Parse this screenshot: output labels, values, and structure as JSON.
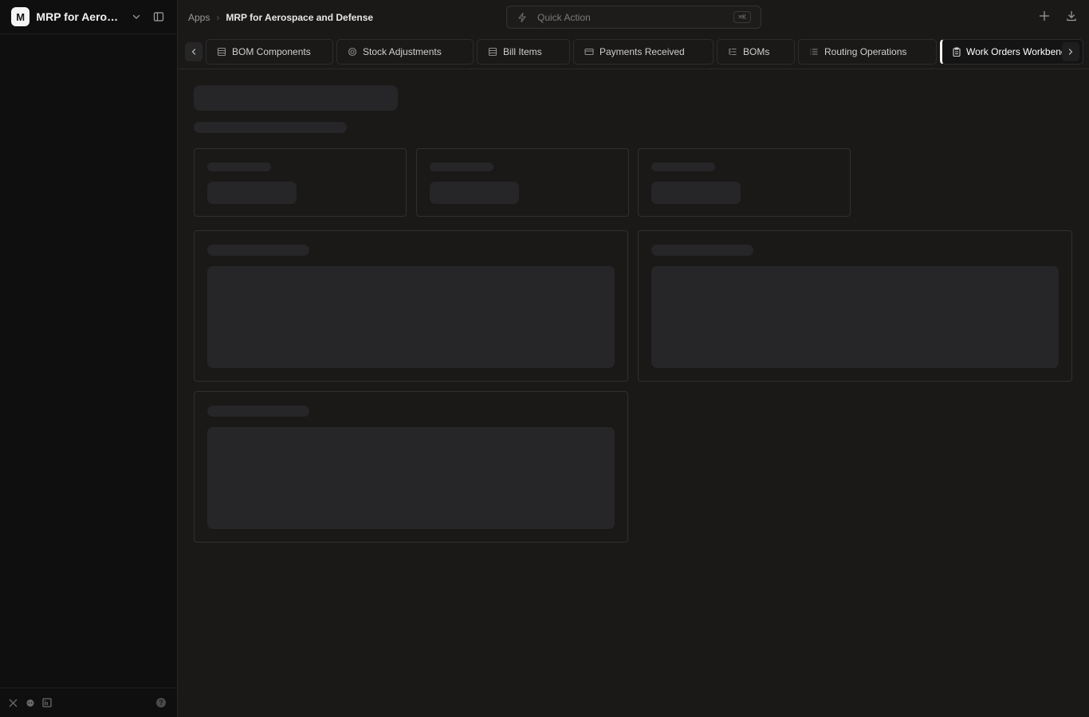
{
  "sidebar": {
    "logo_letter": "M",
    "app_name": "MRP for Aerospace and Defense",
    "footer_icons": [
      "x-logo-icon",
      "reddit-icon",
      "linkedin-icon"
    ],
    "help_label": "?"
  },
  "topbar": {
    "breadcrumb_root": "Apps",
    "breadcrumb_sep": "›",
    "breadcrumb_current": "MRP for Aerospace and Defense",
    "quick_action_label": "Quick Action",
    "quick_action_shortcut": "⌘K"
  },
  "tabs": [
    {
      "label": "BOM Components",
      "icon": "table-icon"
    },
    {
      "label": "Stock Adjustments",
      "icon": "target-icon"
    },
    {
      "label": "Bill Items",
      "icon": "table-icon"
    },
    {
      "label": "Payments Received",
      "icon": "card-icon"
    },
    {
      "label": "BOMs",
      "icon": "list-tree-icon"
    },
    {
      "label": "Routing Operations",
      "icon": "list-icon"
    },
    {
      "label": "Work Orders Workbench",
      "icon": "clipboard-icon",
      "active": true
    }
  ],
  "colors": {
    "background": "#1a1918",
    "sidebar": "#0f0f0f",
    "skeleton": "#262628",
    "border": "#303030"
  }
}
